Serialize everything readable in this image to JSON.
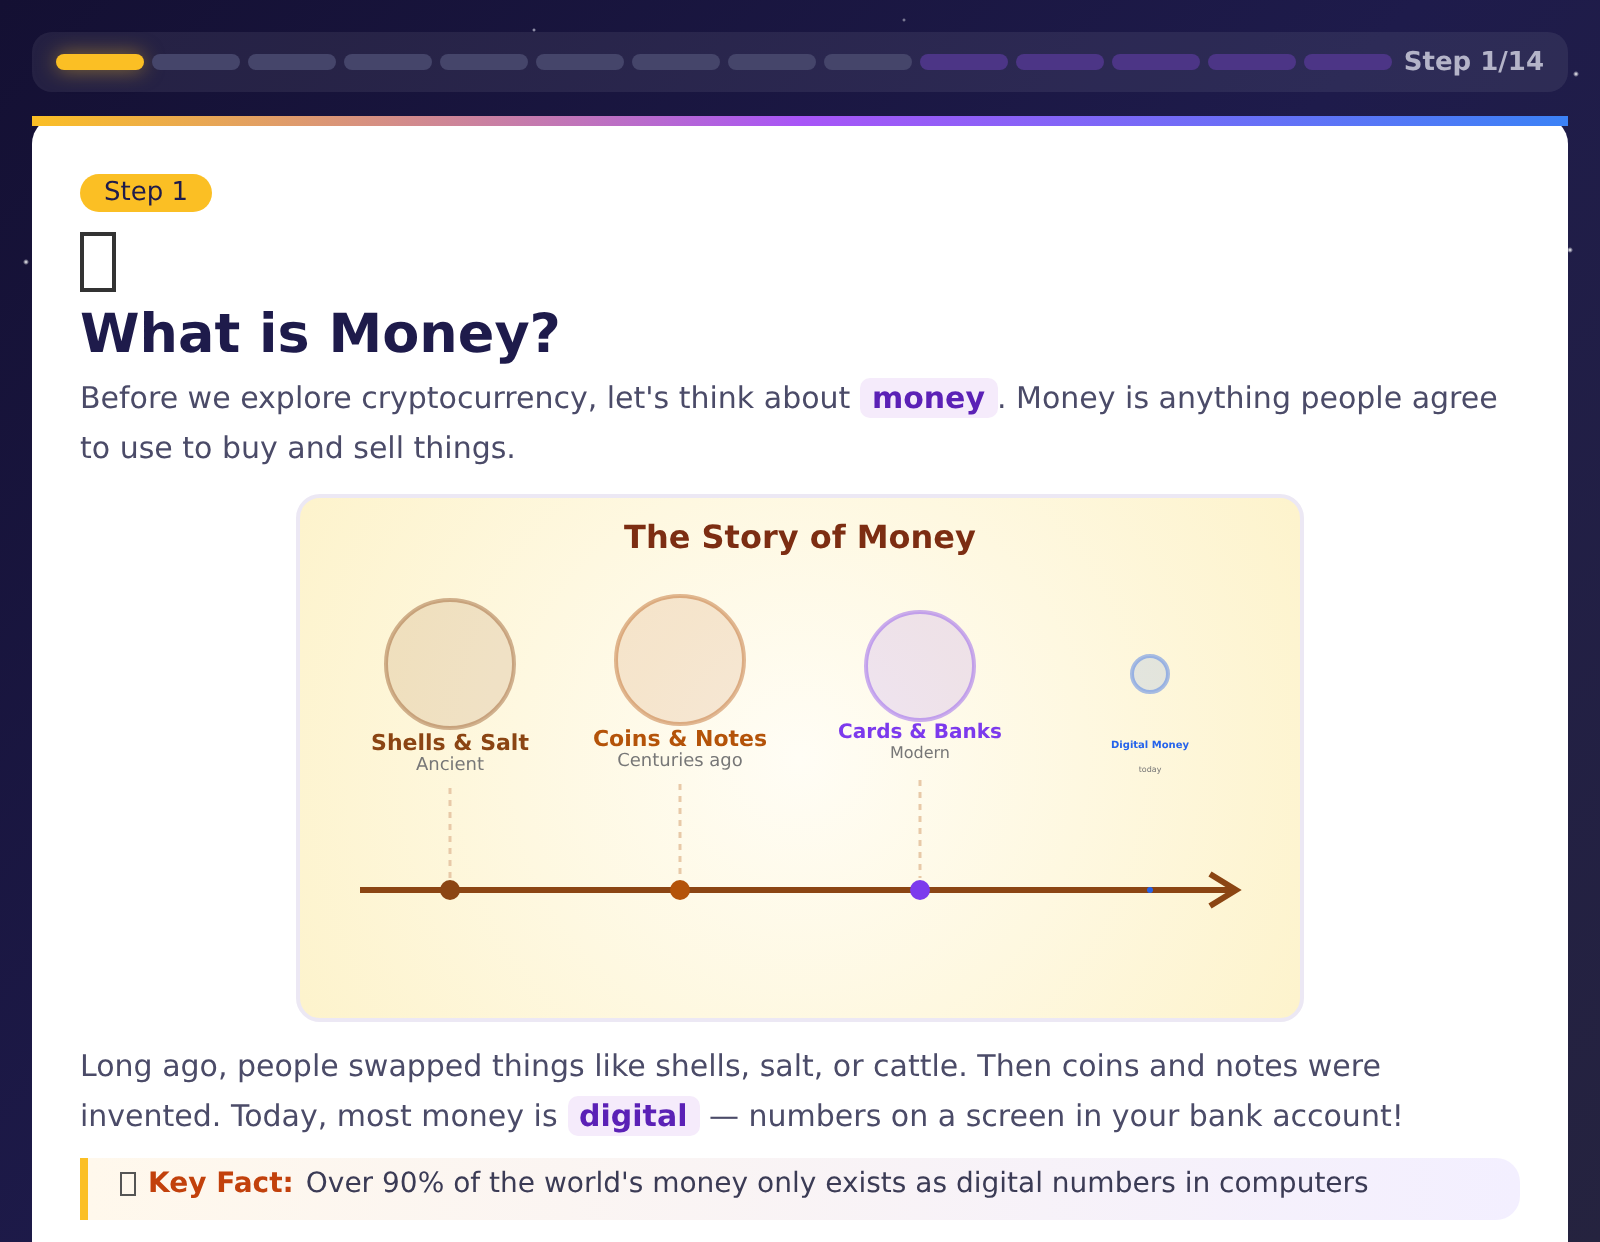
{
  "progress": {
    "steps": [
      {
        "kind": "current"
      },
      {
        "kind": "todo"
      },
      {
        "kind": "todo"
      },
      {
        "kind": "todo"
      },
      {
        "kind": "todo"
      },
      {
        "kind": "todo"
      },
      {
        "kind": "todo"
      },
      {
        "kind": "todo"
      },
      {
        "kind": "todo"
      },
      {
        "kind": "crypto"
      },
      {
        "kind": "crypto"
      },
      {
        "kind": "crypto"
      },
      {
        "kind": "crypto"
      },
      {
        "kind": "crypto"
      }
    ],
    "label": "Step 1/14"
  },
  "card": {
    "badge": "Step 1",
    "title": "What is Money?",
    "intro": {
      "before": "Before we explore cryptocurrency, let's think about ",
      "highlight": "money",
      "after": ". Money is anything people agree to use to buy and sell things."
    },
    "diagram": {
      "title": "The Story of Money",
      "eras": [
        {
          "name": "Shells & Salt",
          "period": "Ancient",
          "color": "#8b4513",
          "kind": "large"
        },
        {
          "name": "Coins & Notes",
          "period": "Centuries ago",
          "color": "#b45309",
          "kind": "large"
        },
        {
          "name": "Cards & Banks",
          "period": "Modern",
          "color": "#7c3aed",
          "kind": "medium"
        },
        {
          "name": "Digital Money",
          "period": "today",
          "color": "#2563eb",
          "kind": "tiny"
        }
      ]
    },
    "story": {
      "before": "Long ago, people swapped things like shells, salt, or cattle. Then coins and notes were invented. Today, most money is ",
      "highlight": "digital",
      "after": " — numbers on a screen in your bank account!"
    },
    "key_fact": {
      "label": "Key Fact:",
      "text": "Over 90% of the world's money only exists as digital numbers in computers"
    }
  }
}
